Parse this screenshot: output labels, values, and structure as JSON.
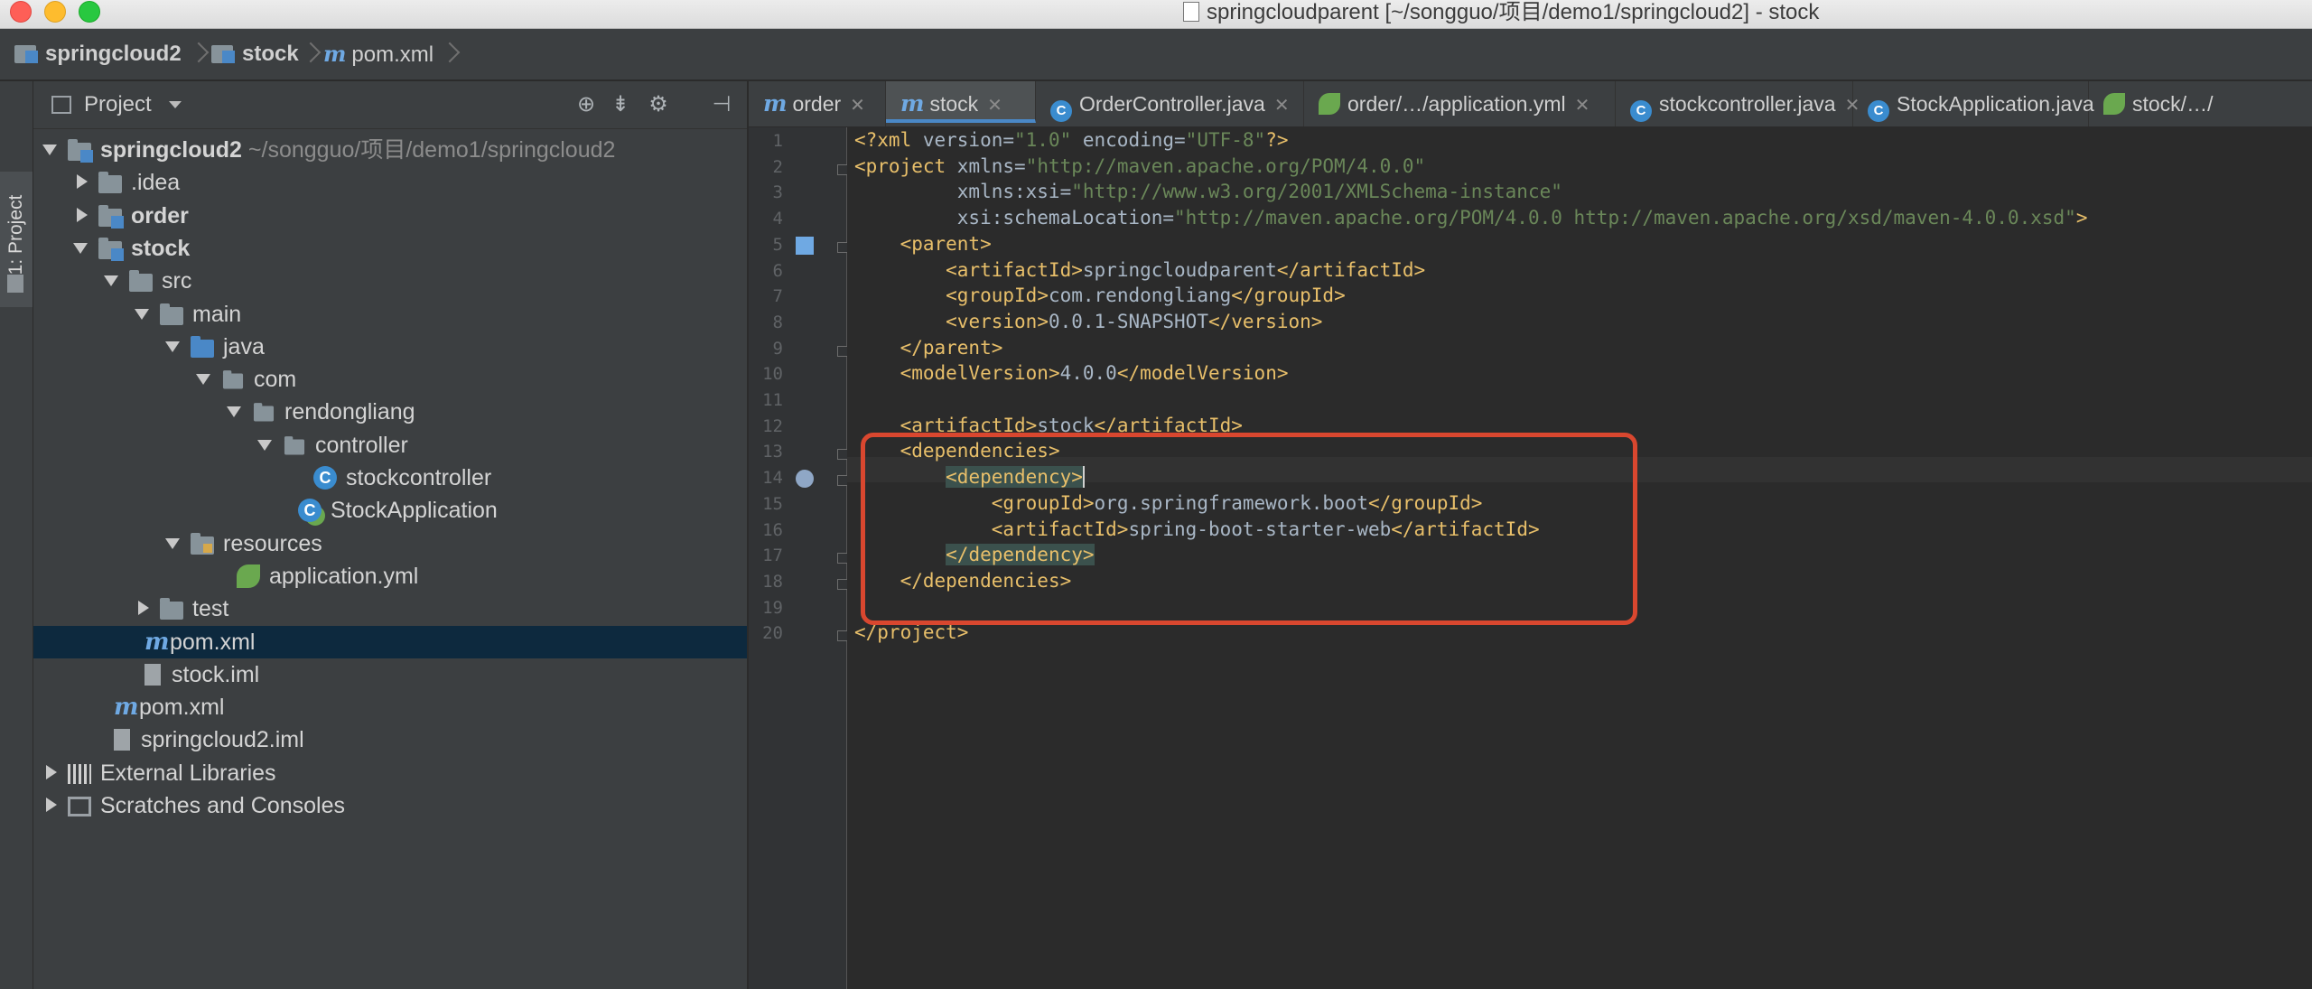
{
  "window": {
    "title": "springcloudparent [~/songguo/项目/demo1/springcloud2] - stock"
  },
  "breadcrumb": [
    "springcloud2",
    "stock",
    "pom.xml"
  ],
  "sidebar_stripe": {
    "label": "1: Project"
  },
  "project_panel": {
    "title": "Project",
    "header_icons": [
      "target-icon",
      "collapse-icon",
      "gear-icon",
      "hide-icon"
    ],
    "tree": [
      {
        "label": "springcloud2",
        "path": "~/songguo/项目/demo1/springcloud2",
        "depth": 0,
        "arrow": "open",
        "icon": "module-folder",
        "bold": true
      },
      {
        "label": ".idea",
        "depth": 1,
        "arrow": "closed",
        "icon": "folder"
      },
      {
        "label": "order",
        "depth": 1,
        "arrow": "closed",
        "icon": "module-folder",
        "bold": true
      },
      {
        "label": "stock",
        "depth": 1,
        "arrow": "open",
        "icon": "module-folder",
        "bold": true
      },
      {
        "label": "src",
        "depth": 2,
        "arrow": "open",
        "icon": "folder"
      },
      {
        "label": "main",
        "depth": 3,
        "arrow": "open",
        "icon": "folder"
      },
      {
        "label": "java",
        "depth": 4,
        "arrow": "open",
        "icon": "source-folder"
      },
      {
        "label": "com",
        "depth": 5,
        "arrow": "open",
        "icon": "package"
      },
      {
        "label": "rendongliang",
        "depth": 6,
        "arrow": "open",
        "icon": "package"
      },
      {
        "label": "controller",
        "depth": 7,
        "arrow": "open",
        "icon": "package"
      },
      {
        "label": "stockcontroller",
        "depth": 8,
        "arrow": "none",
        "icon": "class"
      },
      {
        "label": "StockApplication",
        "depth": 7.5,
        "arrow": "none",
        "icon": "spring-class"
      },
      {
        "label": "resources",
        "depth": 4,
        "arrow": "open",
        "icon": "resources-folder"
      },
      {
        "label": "application.yml",
        "depth": 5.5,
        "arrow": "none",
        "icon": "spring-yml"
      },
      {
        "label": "test",
        "depth": 3,
        "arrow": "closed",
        "icon": "folder"
      },
      {
        "label": "pom.xml",
        "depth": 2.5,
        "arrow": "none",
        "icon": "maven",
        "selected": true
      },
      {
        "label": "stock.iml",
        "depth": 2.5,
        "arrow": "none",
        "icon": "iml"
      },
      {
        "label": "pom.xml",
        "depth": 1.5,
        "arrow": "none",
        "icon": "maven"
      },
      {
        "label": "springcloud2.iml",
        "depth": 1.5,
        "arrow": "none",
        "icon": "iml"
      },
      {
        "label": "External Libraries",
        "depth": 0,
        "arrow": "closed",
        "icon": "libraries"
      },
      {
        "label": "Scratches and Consoles",
        "depth": 0,
        "arrow": "closed",
        "icon": "scratches"
      }
    ]
  },
  "editor_tabs": [
    {
      "label": "order",
      "icon": "maven"
    },
    {
      "label": "stock",
      "icon": "maven",
      "active": true
    },
    {
      "label": "OrderController.java",
      "icon": "class"
    },
    {
      "label": "order/…/application.yml",
      "icon": "spring-yml"
    },
    {
      "label": "stockcontroller.java",
      "icon": "class"
    },
    {
      "label": "StockApplication.java",
      "icon": "spring-class"
    },
    {
      "label": "stock/…/",
      "icon": "spring-yml"
    }
  ],
  "editor": {
    "line_numbers": [
      "1",
      "2",
      "3",
      "4",
      "5",
      "6",
      "7",
      "8",
      "9",
      "10",
      "11",
      "12",
      "13",
      "14",
      "15",
      "16",
      "17",
      "18",
      "19",
      "20"
    ],
    "lines": [
      "<?xml version=\"1.0\" encoding=\"UTF-8\"?>",
      "<project xmlns=\"http://maven.apache.org/POM/4.0.0\"",
      "         xmlns:xsi=\"http://www.w3.org/2001/XMLSchema-instance\"",
      "         xsi:schemaLocation=\"http://maven.apache.org/POM/4.0.0 http://maven.apache.org/xsd/maven-4.0.0.xsd\">",
      "    <parent>",
      "        <artifactId>springcloudparent</artifactId>",
      "        <groupId>com.rendongliang</groupId>",
      "        <version>0.0.1-SNAPSHOT</version>",
      "    </parent>",
      "    <modelVersion>4.0.0</modelVersion>",
      "",
      "    <artifactId>stock</artifactId>",
      "    <dependencies>",
      "        <dependency>",
      "            <groupId>org.springframework.boot</groupId>",
      "            <artifactId>spring-boot-starter-web</artifactId>",
      "        </dependency>",
      "    </dependencies>",
      "",
      "</project>"
    ],
    "caret_line": 14,
    "highlight_annotation_color": "#d9472f"
  },
  "colors": {
    "tag": "#e8bf6a",
    "attr_value": "#6a8759",
    "namespace": "#9876aa",
    "selection": "#0d293e",
    "accent": "#4a88c7"
  }
}
